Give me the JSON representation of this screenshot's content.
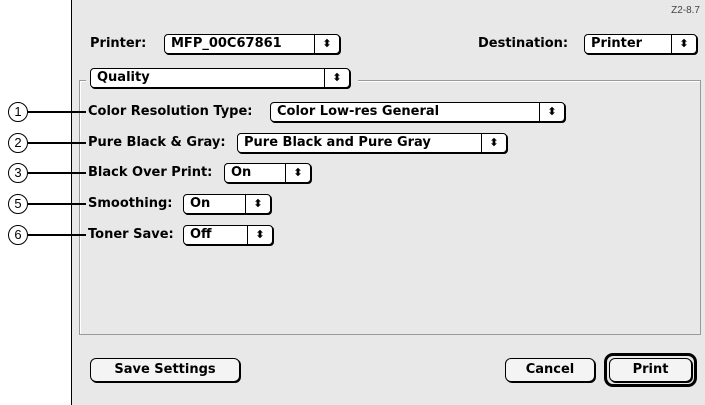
{
  "figure_id": "Z2-8.7",
  "header": {
    "printer_label": "Printer:",
    "printer_value": "MFP_00C67861",
    "destination_label": "Destination:",
    "destination_value": "Printer"
  },
  "panel": {
    "selected": "Quality"
  },
  "settings": [
    {
      "callout": "1",
      "label": "Color Resolution Type:",
      "value": "Color Low-res General"
    },
    {
      "callout": "2",
      "label": "Pure Black & Gray:",
      "value": "Pure Black and Pure Gray"
    },
    {
      "callout": "3",
      "label": "Black Over Print:",
      "value": "On"
    },
    {
      "callout": "5",
      "label": "Smoothing:",
      "value": "On"
    },
    {
      "callout": "6",
      "label": "Toner Save:",
      "value": "Off"
    }
  ],
  "buttons": {
    "save_settings": "Save Settings",
    "cancel": "Cancel",
    "print": "Print"
  },
  "popup_arrow_icon": "updown-arrows-icon",
  "arrow_glyph": "⬍"
}
